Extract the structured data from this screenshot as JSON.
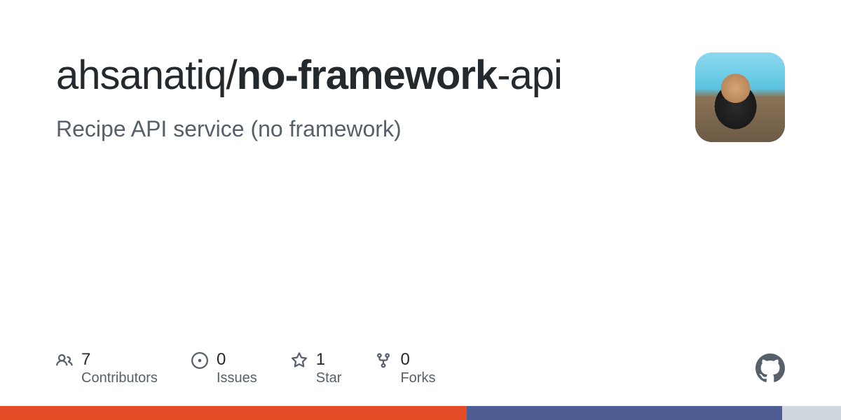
{
  "repo": {
    "owner": "ahsanatiq",
    "slash": "/",
    "name_bold": "no-framework",
    "name_rest": "-api",
    "description": "Recipe API service (no framework)"
  },
  "stats": {
    "contributors": {
      "count": "7",
      "label": "Contributors"
    },
    "issues": {
      "count": "0",
      "label": "Issues"
    },
    "stars": {
      "count": "1",
      "label": "Star"
    },
    "forks": {
      "count": "0",
      "label": "Forks"
    }
  }
}
